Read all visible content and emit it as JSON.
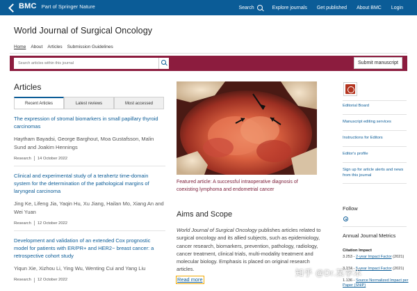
{
  "topbar": {
    "brand": "BMC",
    "brand_sub": "Part of Springer Nature",
    "nav": [
      "Search",
      "Explore journals",
      "Get published",
      "About BMC",
      "Login"
    ]
  },
  "journal": {
    "title": "World Journal of Surgical Oncology",
    "subnav": [
      "Home",
      "About",
      "Articles",
      "Submission Guidelines"
    ]
  },
  "search": {
    "placeholder": "Search articles within this journal",
    "submit_label": "Submit manuscript"
  },
  "articles": {
    "heading": "Articles",
    "tabs": [
      "Recent Articles",
      "Latest reviews",
      "Most accessed"
    ],
    "items": [
      {
        "title": "The expression of stromal biomarkers in small papillary thyroid carcinomas",
        "authors": "Haytham Bayadsi, George Barghout, Moa Gustafsson, Malin Sund and Joakim Hennings",
        "type": "Research",
        "date": "14 October 2022"
      },
      {
        "title": "Clinical and experimental study of a terahertz time-domain system for the determination of the pathological margins of laryngeal carcinoma",
        "authors": "Jing Ke, Lifeng Jia, Yaqin Hu, Xu Jiang, Hailan Mo, Xiang An and Wei Yuan",
        "type": "Research",
        "date": "12 October 2022"
      },
      {
        "title": "Development and validation of an extended Cox prognostic model for patients with ER/PR+ and HER2− breast cancer: a retrospective cohort study",
        "authors": "Yiqun Xie, Xizhou Li, Ying Wu, Wenting Cui and Yang Liu",
        "type": "Research",
        "date": "12 October 2022"
      }
    ]
  },
  "featured": {
    "caption": "Featured article: A successful intraoperative diagnosis of coexisting lymphoma and endometrial cancer"
  },
  "aims": {
    "heading": "Aims and Scope",
    "journal_italic": "World Journal of Surgical Oncology",
    "text": " publishes articles related to surgical oncology and its allied subjects, such as epidemiology, cancer research, biomarkers, prevention, pathology, radiology, cancer treatment, clinical trials, multi-modality treatment and molecular biology. Emphasis is placed on original research articles.",
    "read_more": "Read more"
  },
  "sidebar": {
    "links": [
      "Editorial Board",
      "Manuscript editing services",
      "Instructions for Editors",
      "Editor's profile",
      "Sign up for article alerts and news from this journal"
    ],
    "follow": "Follow",
    "metrics_title": "Annual Journal Metrics",
    "citation_impact": "Citation Impact",
    "metric1_value": "3.253 - ",
    "metric1_link": "2-year Impact Factor",
    "metric1_year": " (2021)",
    "metric2_value": "3.274 - ",
    "metric2_link": "5-year Impact Factor",
    "metric2_year": " (2021)",
    "metric3_value": "1.136 - ",
    "metric3_link": "Source Normalized Impact per Paper (SNIP)"
  },
  "watermark": "知乎 @Dr.某学术",
  "colors": {
    "brand_blue": "#0b5c97",
    "band_maroon": "#8c1c3e",
    "highlight": "#f0a800"
  }
}
